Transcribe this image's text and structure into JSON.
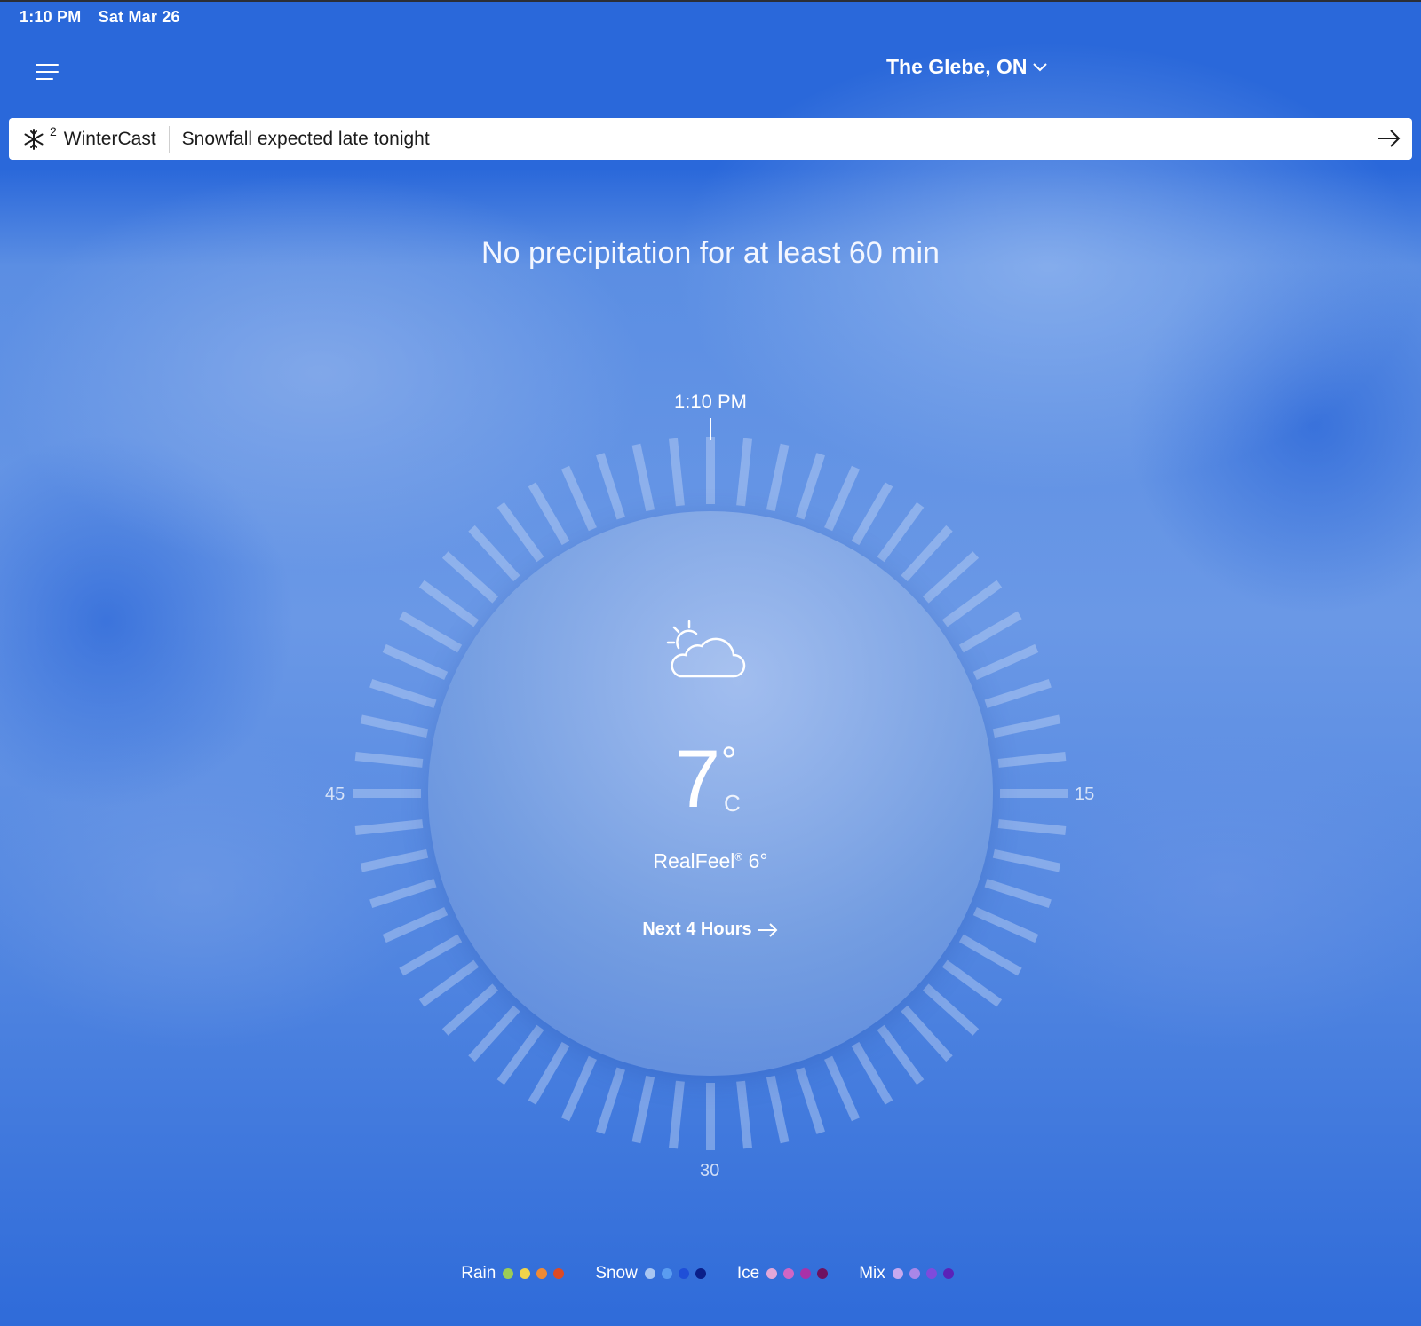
{
  "status_bar": {
    "time": "1:10 PM",
    "date": "Sat Mar 26"
  },
  "header": {
    "location": "The Glebe, ON",
    "menu_icon": "hamburger-menu-icon"
  },
  "alert": {
    "icon": "snowflake-icon",
    "count": "2",
    "brand": "WinterCast",
    "message": "Snowfall expected late tonight"
  },
  "minutecast": {
    "headline": "No precipitation for at least 60 min",
    "current_time": "1:10 PM",
    "minute_labels": {
      "right": "15",
      "bottom": "30",
      "left": "45"
    }
  },
  "current": {
    "condition_icon": "partly-sunny-cloud-icon",
    "temperature": "7",
    "degree": "°",
    "unit": "C",
    "realfeel_label": "RealFeel",
    "realfeel_mark": "®",
    "realfeel_value": " 6°",
    "next_hours_link": "Next 4 Hours"
  },
  "legend": [
    {
      "label": "Rain",
      "colors": [
        "#9ccc55",
        "#f1d44a",
        "#ef8a35",
        "#dd4a25"
      ]
    },
    {
      "label": "Snow",
      "colors": [
        "#a9c6f2",
        "#5a9cf0",
        "#1f4fd8",
        "#0a1f8a"
      ]
    },
    {
      "label": "Ice",
      "colors": [
        "#e3a7d8",
        "#cf66c4",
        "#a931a8",
        "#6e1260"
      ]
    },
    {
      "label": "Mix",
      "colors": [
        "#c7a9ef",
        "#a987e8",
        "#7e4bdc",
        "#5a22b8"
      ]
    }
  ]
}
